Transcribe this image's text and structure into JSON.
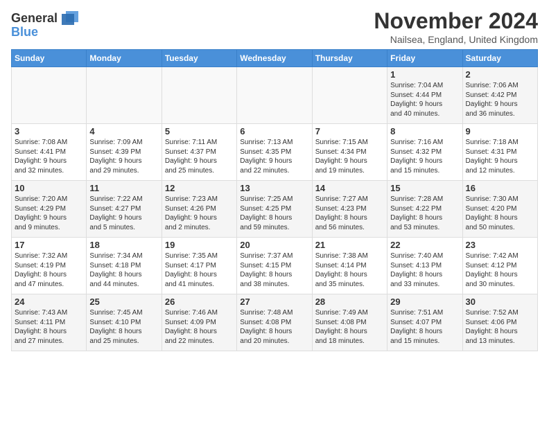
{
  "header": {
    "logo_line1": "General",
    "logo_line2": "Blue",
    "month_title": "November 2024",
    "location": "Nailsea, England, United Kingdom"
  },
  "weekdays": [
    "Sunday",
    "Monday",
    "Tuesday",
    "Wednesday",
    "Thursday",
    "Friday",
    "Saturday"
  ],
  "weeks": [
    [
      {
        "day": "",
        "info": ""
      },
      {
        "day": "",
        "info": ""
      },
      {
        "day": "",
        "info": ""
      },
      {
        "day": "",
        "info": ""
      },
      {
        "day": "",
        "info": ""
      },
      {
        "day": "1",
        "info": "Sunrise: 7:04 AM\nSunset: 4:44 PM\nDaylight: 9 hours\nand 40 minutes."
      },
      {
        "day": "2",
        "info": "Sunrise: 7:06 AM\nSunset: 4:42 PM\nDaylight: 9 hours\nand 36 minutes."
      }
    ],
    [
      {
        "day": "3",
        "info": "Sunrise: 7:08 AM\nSunset: 4:41 PM\nDaylight: 9 hours\nand 32 minutes."
      },
      {
        "day": "4",
        "info": "Sunrise: 7:09 AM\nSunset: 4:39 PM\nDaylight: 9 hours\nand 29 minutes."
      },
      {
        "day": "5",
        "info": "Sunrise: 7:11 AM\nSunset: 4:37 PM\nDaylight: 9 hours\nand 25 minutes."
      },
      {
        "day": "6",
        "info": "Sunrise: 7:13 AM\nSunset: 4:35 PM\nDaylight: 9 hours\nand 22 minutes."
      },
      {
        "day": "7",
        "info": "Sunrise: 7:15 AM\nSunset: 4:34 PM\nDaylight: 9 hours\nand 19 minutes."
      },
      {
        "day": "8",
        "info": "Sunrise: 7:16 AM\nSunset: 4:32 PM\nDaylight: 9 hours\nand 15 minutes."
      },
      {
        "day": "9",
        "info": "Sunrise: 7:18 AM\nSunset: 4:31 PM\nDaylight: 9 hours\nand 12 minutes."
      }
    ],
    [
      {
        "day": "10",
        "info": "Sunrise: 7:20 AM\nSunset: 4:29 PM\nDaylight: 9 hours\nand 9 minutes."
      },
      {
        "day": "11",
        "info": "Sunrise: 7:22 AM\nSunset: 4:27 PM\nDaylight: 9 hours\nand 5 minutes."
      },
      {
        "day": "12",
        "info": "Sunrise: 7:23 AM\nSunset: 4:26 PM\nDaylight: 9 hours\nand 2 minutes."
      },
      {
        "day": "13",
        "info": "Sunrise: 7:25 AM\nSunset: 4:25 PM\nDaylight: 8 hours\nand 59 minutes."
      },
      {
        "day": "14",
        "info": "Sunrise: 7:27 AM\nSunset: 4:23 PM\nDaylight: 8 hours\nand 56 minutes."
      },
      {
        "day": "15",
        "info": "Sunrise: 7:28 AM\nSunset: 4:22 PM\nDaylight: 8 hours\nand 53 minutes."
      },
      {
        "day": "16",
        "info": "Sunrise: 7:30 AM\nSunset: 4:20 PM\nDaylight: 8 hours\nand 50 minutes."
      }
    ],
    [
      {
        "day": "17",
        "info": "Sunrise: 7:32 AM\nSunset: 4:19 PM\nDaylight: 8 hours\nand 47 minutes."
      },
      {
        "day": "18",
        "info": "Sunrise: 7:34 AM\nSunset: 4:18 PM\nDaylight: 8 hours\nand 44 minutes."
      },
      {
        "day": "19",
        "info": "Sunrise: 7:35 AM\nSunset: 4:17 PM\nDaylight: 8 hours\nand 41 minutes."
      },
      {
        "day": "20",
        "info": "Sunrise: 7:37 AM\nSunset: 4:15 PM\nDaylight: 8 hours\nand 38 minutes."
      },
      {
        "day": "21",
        "info": "Sunrise: 7:38 AM\nSunset: 4:14 PM\nDaylight: 8 hours\nand 35 minutes."
      },
      {
        "day": "22",
        "info": "Sunrise: 7:40 AM\nSunset: 4:13 PM\nDaylight: 8 hours\nand 33 minutes."
      },
      {
        "day": "23",
        "info": "Sunrise: 7:42 AM\nSunset: 4:12 PM\nDaylight: 8 hours\nand 30 minutes."
      }
    ],
    [
      {
        "day": "24",
        "info": "Sunrise: 7:43 AM\nSunset: 4:11 PM\nDaylight: 8 hours\nand 27 minutes."
      },
      {
        "day": "25",
        "info": "Sunrise: 7:45 AM\nSunset: 4:10 PM\nDaylight: 8 hours\nand 25 minutes."
      },
      {
        "day": "26",
        "info": "Sunrise: 7:46 AM\nSunset: 4:09 PM\nDaylight: 8 hours\nand 22 minutes."
      },
      {
        "day": "27",
        "info": "Sunrise: 7:48 AM\nSunset: 4:08 PM\nDaylight: 8 hours\nand 20 minutes."
      },
      {
        "day": "28",
        "info": "Sunrise: 7:49 AM\nSunset: 4:08 PM\nDaylight: 8 hours\nand 18 minutes."
      },
      {
        "day": "29",
        "info": "Sunrise: 7:51 AM\nSunset: 4:07 PM\nDaylight: 8 hours\nand 15 minutes."
      },
      {
        "day": "30",
        "info": "Sunrise: 7:52 AM\nSunset: 4:06 PM\nDaylight: 8 hours\nand 13 minutes."
      }
    ]
  ]
}
